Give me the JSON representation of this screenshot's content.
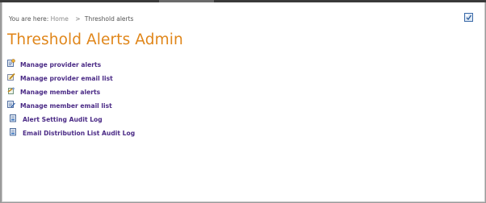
{
  "breadcrumb": {
    "prefix": "You are here:",
    "home": "Home",
    "separator": ">",
    "current": "Threshold alerts"
  },
  "page": {
    "title": "Threshold Alerts Admin"
  },
  "links": [
    {
      "label": "Manage provider alerts",
      "icon": "alert-settings-icon"
    },
    {
      "label": "Manage provider email list",
      "icon": "edit-list-icon"
    },
    {
      "label": "Manage member alerts",
      "icon": "alert-settings-icon"
    },
    {
      "label": "Manage member email list",
      "icon": "edit-list-icon"
    },
    {
      "label": "Alert Setting Audit Log",
      "icon": "audit-log-icon"
    },
    {
      "label": "Email Distribution List Audit Log",
      "icon": "audit-log-icon"
    }
  ],
  "colors": {
    "title": "#e0861a",
    "link": "#4b2b86"
  }
}
